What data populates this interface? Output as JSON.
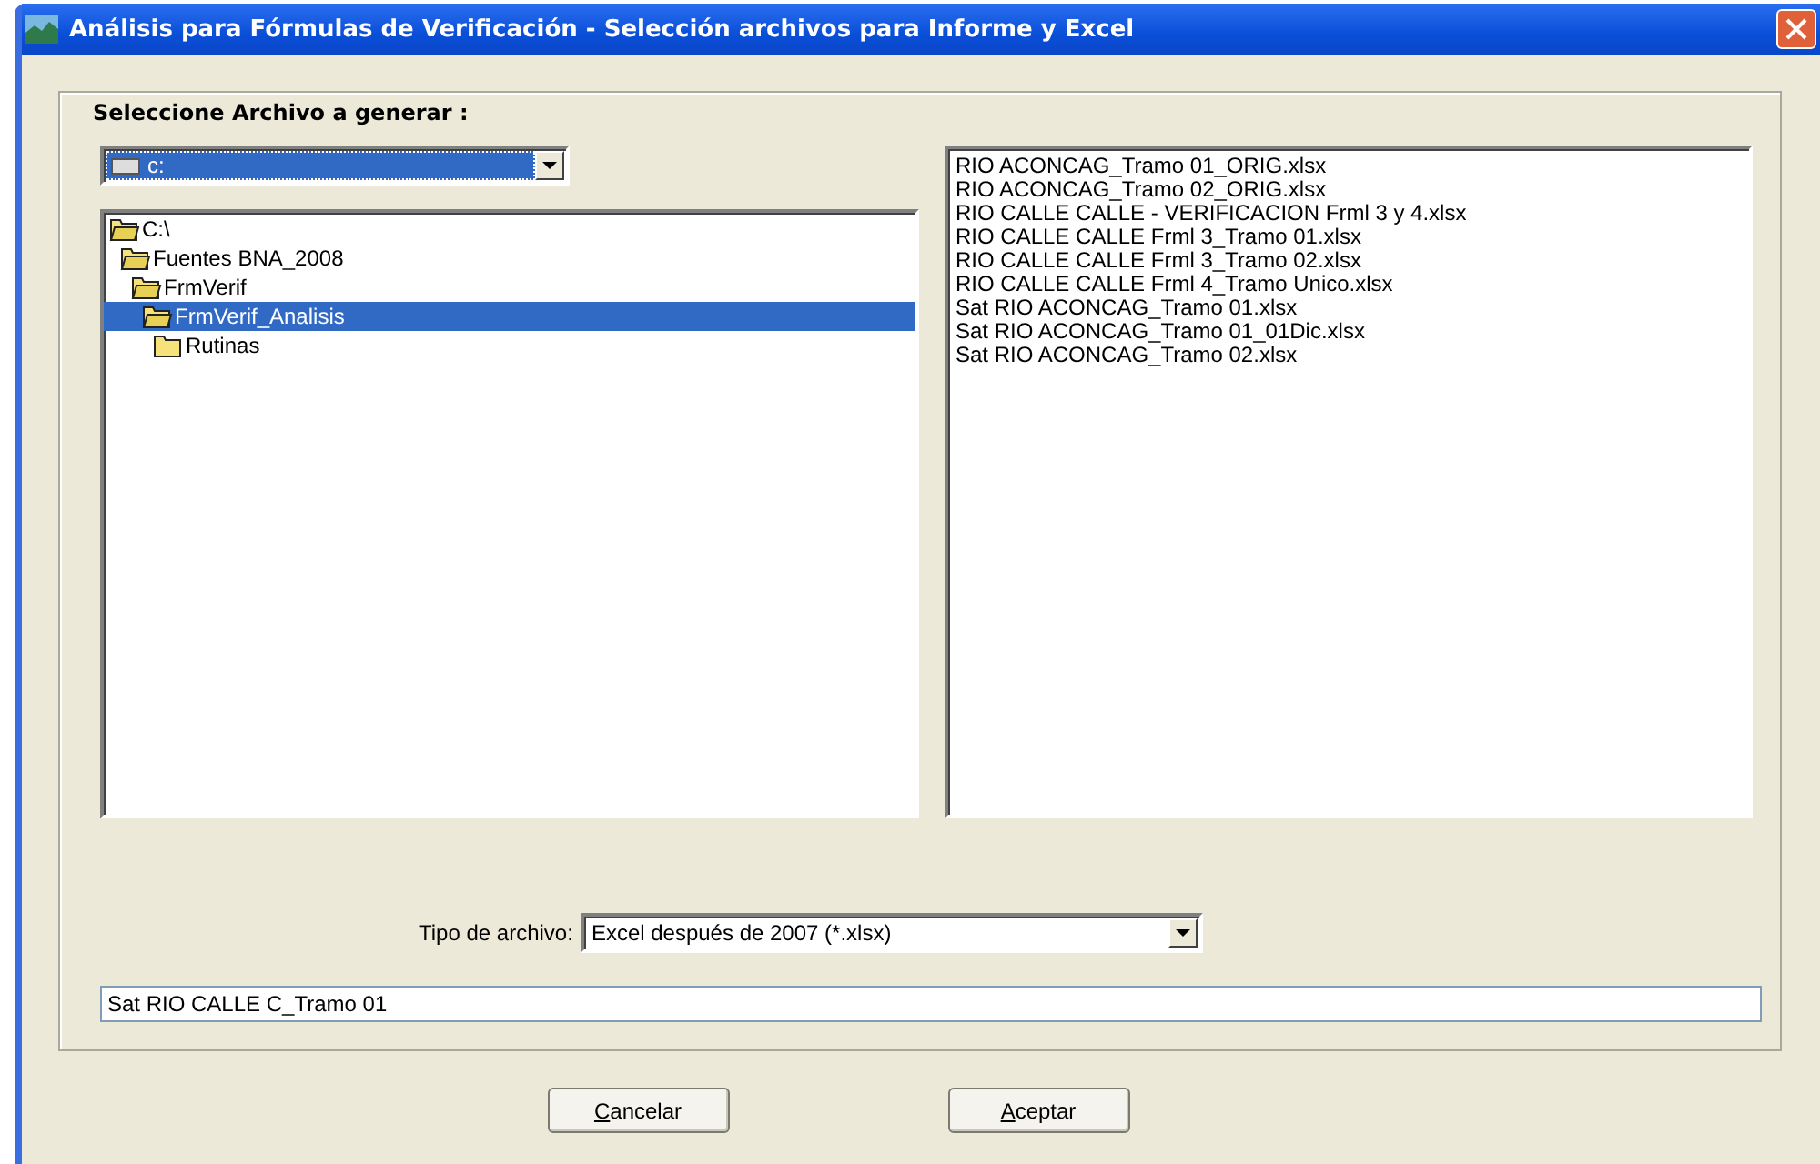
{
  "window": {
    "title": "Análisis para Fórmulas de Verificación - Selección archivos para Informe y Excel"
  },
  "group": {
    "label": "Seleccione Archivo a generar :"
  },
  "drive": {
    "value": "c:"
  },
  "folders": [
    {
      "name": "C:\\",
      "expanded": true,
      "selected": false,
      "children": [
        {
          "name": "Fuentes BNA_2008",
          "expanded": true,
          "selected": false,
          "children": [
            {
              "name": "FrmVerif",
              "expanded": true,
              "selected": false,
              "children": [
                {
                  "name": "FrmVerif_Analisis",
                  "expanded": true,
                  "selected": true,
                  "children": [
                    {
                      "name": "Rutinas",
                      "expanded": false,
                      "selected": false
                    }
                  ]
                }
              ]
            }
          ]
        }
      ]
    }
  ],
  "files": [
    "RIO ACONCAG_Tramo 01_ORIG.xlsx",
    "RIO ACONCAG_Tramo 02_ORIG.xlsx",
    "RIO CALLE CALLE - VERIFICACION Frml 3 y 4.xlsx",
    "RIO CALLE CALLE Frml 3_Tramo 01.xlsx",
    "RIO CALLE CALLE Frml 3_Tramo 02.xlsx",
    "RIO CALLE CALLE Frml 4_Tramo Unico.xlsx",
    "Sat RIO ACONCAG_Tramo 01.xlsx",
    "Sat RIO ACONCAG_Tramo 01_01Dic.xlsx",
    "Sat RIO ACONCAG_Tramo 02.xlsx"
  ],
  "file_type": {
    "label": "Tipo de archivo:",
    "value": "Excel después de 2007 (*.xlsx)"
  },
  "file_name": {
    "value": "Sat RIO CALLE C_Tramo 01"
  },
  "buttons": [
    {
      "label": "Cancelar"
    },
    {
      "label": "Aceptar"
    }
  ]
}
